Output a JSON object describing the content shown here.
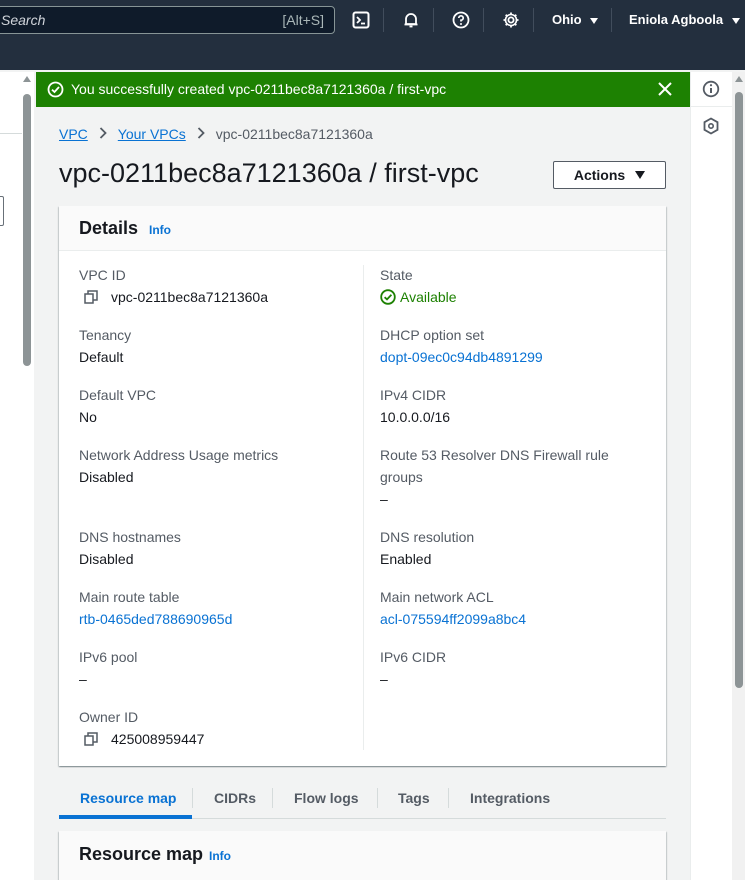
{
  "topnav": {
    "search_placeholder": "Search",
    "search_shortcut": "[Alt+S]",
    "region": "Ohio",
    "user": "Eniola Agboola"
  },
  "flash": {
    "message": "You successfully created vpc-0211bec8a7121360a / first-vpc",
    "color": "#1d8102"
  },
  "breadcrumb": {
    "items": [
      "VPC",
      "Your VPCs",
      "vpc-0211bec8a7121360a"
    ]
  },
  "page": {
    "title": "vpc-0211bec8a7121360a / first-vpc",
    "actions_label": "Actions"
  },
  "details": {
    "title": "Details",
    "info": "Info",
    "left": [
      {
        "label": "VPC ID",
        "value": "vpc-0211bec8a7121360a"
      },
      {
        "label": "Tenancy",
        "value": "Default"
      },
      {
        "label": "Default VPC",
        "value": "No"
      },
      {
        "label": "Network Address Usage metrics",
        "value": "Disabled"
      },
      {
        "label": "DNS hostnames",
        "value": "Disabled"
      },
      {
        "label": "Main route table",
        "value": "rtb-0465ded788690965d"
      },
      {
        "label": "IPv6 pool",
        "value": "–"
      },
      {
        "label": "Owner ID",
        "value": "425008959447"
      }
    ],
    "right": [
      {
        "label": "State",
        "value": "Available"
      },
      {
        "label": "DHCP option set",
        "value": "dopt-09ec0c94db4891299"
      },
      {
        "label": "IPv4 CIDR",
        "value": "10.0.0.0/16"
      },
      {
        "label": "Route 53 Resolver DNS Firewall rule",
        "label2": "groups",
        "value": "–"
      },
      {
        "label": "DNS resolution",
        "value": "Enabled"
      },
      {
        "label": "Main network ACL",
        "value": "acl-075594ff2099a8bc4"
      },
      {
        "label": "IPv6 CIDR",
        "value": "–"
      }
    ]
  },
  "tabs": [
    "Resource map",
    "CIDRs",
    "Flow logs",
    "Tags",
    "Integrations"
  ],
  "resource_map": {
    "title": "Resource map",
    "info": "Info"
  },
  "colors": {
    "link": "#0972d3",
    "nav_bg": "#232f3e",
    "success": "#1d8102"
  }
}
